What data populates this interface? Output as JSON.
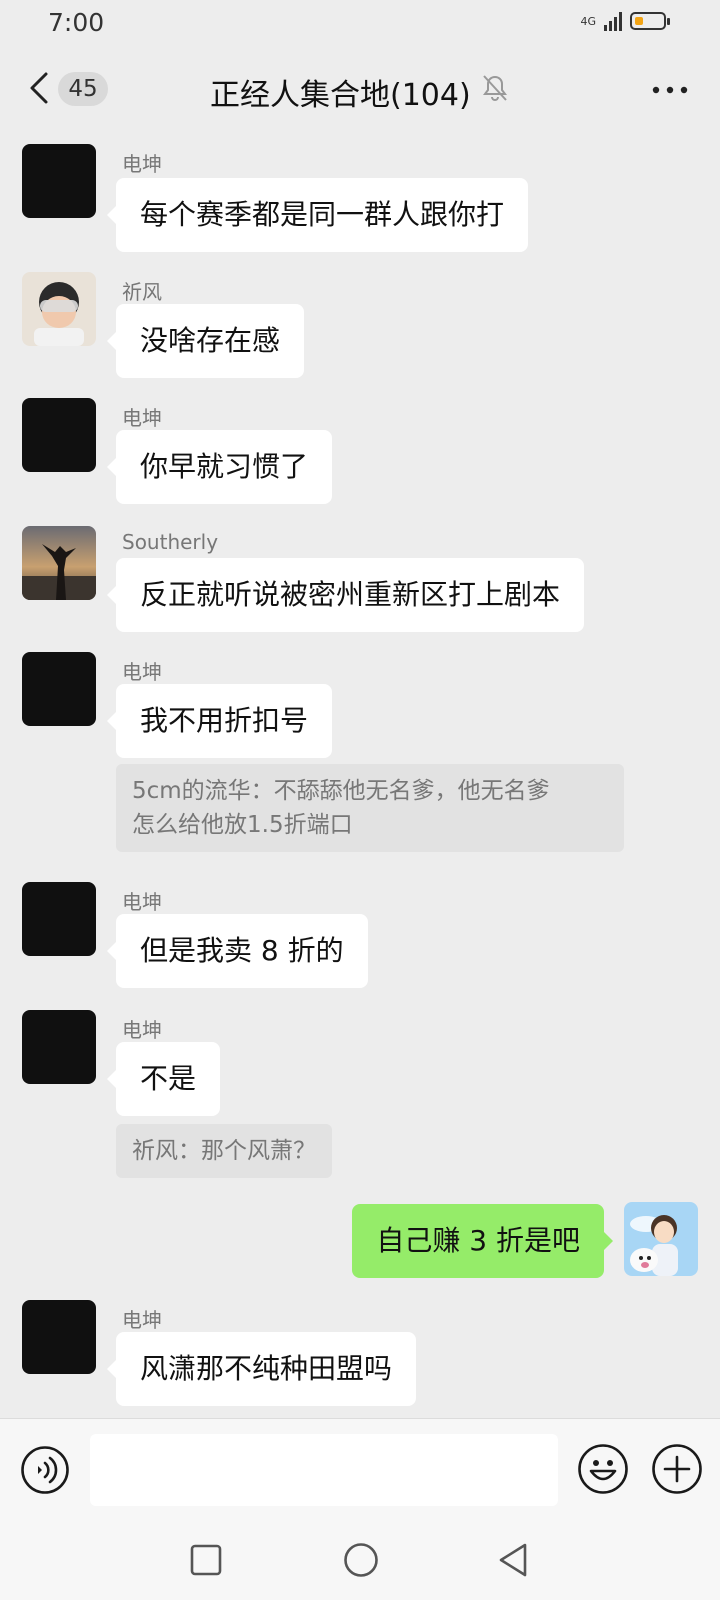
{
  "status": {
    "time": "7:00",
    "network": "4G",
    "battery_level": 0.3,
    "battery_color": "#f3a414"
  },
  "header": {
    "unread_count": "45",
    "title": "正经人集合地(104)",
    "mute_icon": "bell-muted-icon",
    "more_icon": "more-dots-icon"
  },
  "messages": [
    {
      "sender": "电坤",
      "text": "每个赛季都是同一群人跟你打",
      "avatar": "dark"
    },
    {
      "sender": "祈风",
      "text": "没啥存在感",
      "avatar": "photo-child"
    },
    {
      "sender": "电坤",
      "text": "你早就习惯了",
      "avatar": "dark"
    },
    {
      "sender": "Southerly",
      "text": "反正就听说被密州重新区打上剧本",
      "avatar": "photo-sunset"
    },
    {
      "sender": "电坤",
      "text": "我不用折扣号",
      "avatar": "dark",
      "quote_lines": [
        "5cm的流华：不舔舔他无名爹，他无名爹",
        "怎么给他放1.5折端口"
      ]
    },
    {
      "sender": "电坤",
      "text": "但是我卖 8 折的",
      "avatar": "dark"
    },
    {
      "sender": "电坤",
      "text": "不是",
      "avatar": "dark",
      "quote": "祈风：那个风萧？"
    },
    {
      "sender": "",
      "text": "自己赚 3 折是吧",
      "avatar": "photo-anime",
      "mine": true
    },
    {
      "sender": "电坤",
      "text": "风潇那不纯种田盟吗",
      "avatar": "dark"
    }
  ],
  "input": {
    "placeholder": "",
    "voice_icon": "voice-icon",
    "emoji_icon": "emoji-icon",
    "plus_icon": "plus-icon"
  },
  "nav": {
    "recent_icon": "square-icon",
    "home_icon": "circle-icon",
    "back_icon": "triangle-back-icon"
  },
  "colors": {
    "background": "#ededed",
    "my_bubble": "#95ec69",
    "other_bubble": "#ffffff"
  }
}
